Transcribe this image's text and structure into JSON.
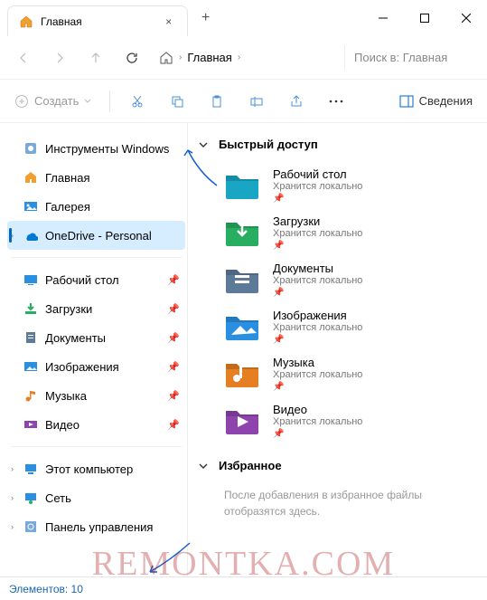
{
  "window": {
    "tab_title": "Главная",
    "new_tab": "+",
    "close_tab": "×"
  },
  "nav": {
    "breadcrumb": "Главная",
    "search_placeholder": "Поиск в: Главная"
  },
  "toolbar": {
    "create": "Создать",
    "details": "Сведения"
  },
  "sidebar": {
    "group1": [
      {
        "label": "Инструменты Windows",
        "icon": "tools"
      },
      {
        "label": "Главная",
        "icon": "home"
      },
      {
        "label": "Галерея",
        "icon": "gallery"
      },
      {
        "label": "OneDrive - Personal",
        "icon": "onedrive",
        "selected": true,
        "chev": true
      }
    ],
    "group2": [
      {
        "label": "Рабочий стол",
        "icon": "desktop",
        "pin": true
      },
      {
        "label": "Загрузки",
        "icon": "downloads",
        "pin": true
      },
      {
        "label": "Документы",
        "icon": "documents",
        "pin": true
      },
      {
        "label": "Изображения",
        "icon": "pictures",
        "pin": true
      },
      {
        "label": "Музыка",
        "icon": "music",
        "pin": true
      },
      {
        "label": "Видео",
        "icon": "video",
        "pin": true
      }
    ],
    "group3": [
      {
        "label": "Этот компьютер",
        "icon": "pc",
        "chev": true
      },
      {
        "label": "Сеть",
        "icon": "network",
        "chev": true
      },
      {
        "label": "Панель управления",
        "icon": "control",
        "chev": true
      }
    ]
  },
  "main": {
    "quick_access_title": "Быстрый доступ",
    "favorites_title": "Избранное",
    "favorites_empty": "После добавления в избранное файлы отобразятся здесь.",
    "items": [
      {
        "name": "Рабочий стол",
        "sub": "Хранится локально",
        "color": "#19a5c4"
      },
      {
        "name": "Загрузки",
        "sub": "Хранится локально",
        "color": "#27ae60"
      },
      {
        "name": "Документы",
        "sub": "Хранится локально",
        "color": "#5d7a99"
      },
      {
        "name": "Изображения",
        "sub": "Хранится локально",
        "color": "#2a8fe0"
      },
      {
        "name": "Музыка",
        "sub": "Хранится локально",
        "color": "#e67e22"
      },
      {
        "name": "Видео",
        "sub": "Хранится локально",
        "color": "#8e44ad"
      }
    ]
  },
  "status": {
    "count_label": "Элементов: 10"
  },
  "watermark": "REMONTKA.COM"
}
